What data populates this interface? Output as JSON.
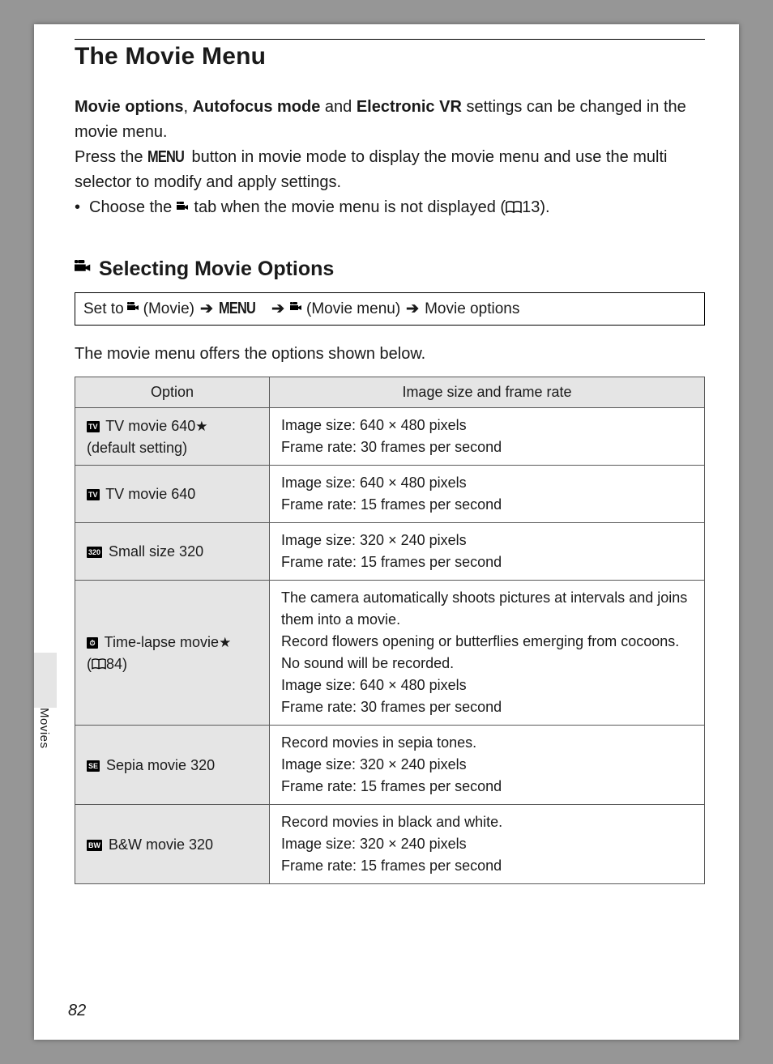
{
  "title": "The Movie Menu",
  "para1_prefix": "Movie options",
  "para1_comma": ", ",
  "para1_b2": "Autofocus mode",
  "para1_and": " and ",
  "para1_b3": "Electronic VR",
  "para1_suffix": " settings can be changed in the movie menu.",
  "para2_a": "Press the ",
  "para2_menu": "MENU",
  "para2_b": " button in movie mode to display the movie menu and use the multi selector to modify and apply settings.",
  "bullet1_a": "Choose the ",
  "bullet1_b": " tab when the movie menu is not displayed (",
  "bullet1_ref": "13).",
  "subheading": "Selecting Movie Options",
  "path_a": "Set to ",
  "path_movie": " (Movie) ",
  "path_menu": "MENU",
  "path_moviemenu": " (Movie menu) ",
  "path_end": " Movie options",
  "table_intro": "The movie menu offers the options shown below.",
  "headers": {
    "option": "Option",
    "desc": "Image size and frame rate"
  },
  "rows": [
    {
      "icon": "TV",
      "label_a": "TV movie 640",
      "star": true,
      "label_b": "(default setting)",
      "desc": "Image size: 640 × 480 pixels\nFrame rate: 30 frames per second"
    },
    {
      "icon": "TV",
      "label_a": "TV movie 640",
      "star": false,
      "label_b": "",
      "desc": "Image size: 640 × 480 pixels\nFrame rate: 15 frames per second"
    },
    {
      "icon": "320",
      "label_a": "Small size 320",
      "star": false,
      "label_b": "",
      "desc": "Image size: 320 × 240 pixels\nFrame rate: 15 frames per second"
    },
    {
      "icon": "⏱",
      "label_a": "Time-lapse movie",
      "star": true,
      "label_b_book": true,
      "label_b": "84)",
      "desc": "The camera automatically shoots pictures at intervals and joins them into a movie.\nRecord flowers opening or butterflies emerging from cocoons.\nNo sound will be recorded.\nImage size: 640 × 480 pixels\nFrame rate: 30 frames per second"
    },
    {
      "icon": "SE",
      "label_a": "Sepia movie 320",
      "star": false,
      "label_b": "",
      "desc": "Record movies in sepia tones.\nImage size: 320 × 240 pixels\nFrame rate: 15 frames per second"
    },
    {
      "icon": "BW",
      "label_a": "B&W movie 320",
      "star": false,
      "label_b": "",
      "desc": "Record movies in black and white.\nImage size: 320 × 240 pixels\nFrame rate: 15 frames per second"
    }
  ],
  "side_label": "Movies",
  "page_num": "82"
}
